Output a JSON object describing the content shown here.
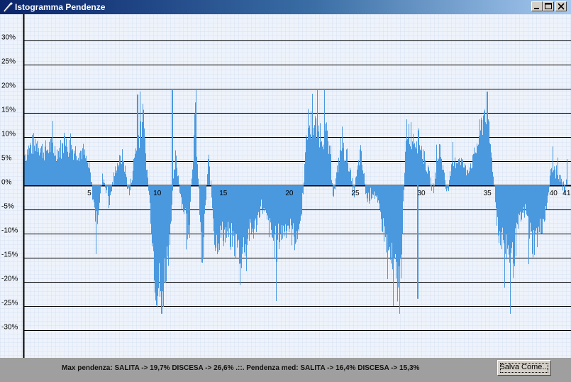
{
  "window": {
    "title": "Istogramma Pendenze"
  },
  "status": {
    "text": "Max pendenza: SALITA -> 19,7% DISCESA -> 26,6% .::. Pendenza med: SALITA -> 16,4% DISCESA -> 15,3%",
    "save_label": "Salva Come..."
  },
  "colors": {
    "bar": "#4a98de",
    "titlebar": "#0a246a",
    "grid": "#000000",
    "plot_bg": "#eef3fb"
  },
  "chart_data": {
    "type": "bar",
    "title": "",
    "xlabel": "",
    "ylabel": "",
    "ylim": [
      -35,
      35
    ],
    "xlim": [
      0,
      41.2
    ],
    "y_ticks": [
      30,
      25,
      20,
      15,
      10,
      5,
      0,
      -5,
      -10,
      -15,
      -20,
      -25,
      -30
    ],
    "y_tick_labels": [
      "30%",
      "25%",
      "20%",
      "15%",
      "10%",
      "5%",
      "0%",
      "-5%",
      "-10%",
      "-15%",
      "-20%",
      "-25%",
      "-30%"
    ],
    "x_ticks": [
      5,
      10,
      15,
      20,
      25,
      30,
      35,
      40,
      41
    ],
    "x_tick_labels": [
      "5",
      "10",
      "15",
      "20",
      "25",
      "30",
      "35",
      "40",
      "41"
    ],
    "grid": "horizontal",
    "series": [
      {
        "profile_km": [
          0,
          0.5,
          1,
          1.5,
          2,
          2.5,
          3,
          3.5,
          4,
          4.5,
          5,
          5.5,
          6,
          6.5,
          7,
          7.5,
          8,
          8.5,
          9,
          9.5,
          10,
          10.5,
          11,
          11.5,
          12,
          12.5,
          13,
          13.5,
          14,
          14.5,
          15,
          15.5,
          16,
          16.5,
          17,
          17.5,
          18,
          18.5,
          19,
          19.5,
          20,
          20.5,
          21,
          21.5,
          22,
          22.5,
          23,
          23.5,
          24,
          24.5,
          25,
          25.5,
          26,
          26.5,
          27,
          27.5,
          28,
          28.5,
          29,
          29.5,
          30,
          30.5,
          31,
          31.5,
          32,
          32.5,
          33,
          33.5,
          34,
          34.5,
          35,
          35.5,
          36,
          36.5,
          37,
          37.5,
          38,
          38.5,
          39,
          39.5,
          40,
          40.5,
          41,
          41.2
        ],
        "profile_pct": [
          6,
          8,
          9,
          7,
          8,
          7,
          8,
          8,
          7,
          7,
          3,
          -8,
          2,
          -3,
          4,
          6,
          -2,
          8,
          14,
          -2,
          -20,
          -22,
          -12,
          6,
          -4,
          -8,
          14,
          -16,
          6,
          -12,
          -10,
          -10,
          -12,
          -14,
          -10,
          -9,
          -4,
          -8,
          -12,
          -10,
          -8,
          -11,
          -7,
          13,
          12,
          11,
          10,
          -2,
          8,
          6,
          -2,
          7,
          -3,
          -1,
          -6,
          -12,
          -18,
          -20,
          12,
          10,
          9,
          4,
          -1,
          8,
          -1,
          4,
          6,
          3,
          5,
          10,
          17,
          4,
          -10,
          -12,
          -16,
          -8,
          -5,
          -12,
          -10,
          -6,
          4,
          2,
          -1,
          6
        ],
        "max_up_pct": 19.7,
        "max_down_pct": -26.6,
        "mean_up_pct": 16.4,
        "mean_down_pct": -15.3
      }
    ]
  }
}
